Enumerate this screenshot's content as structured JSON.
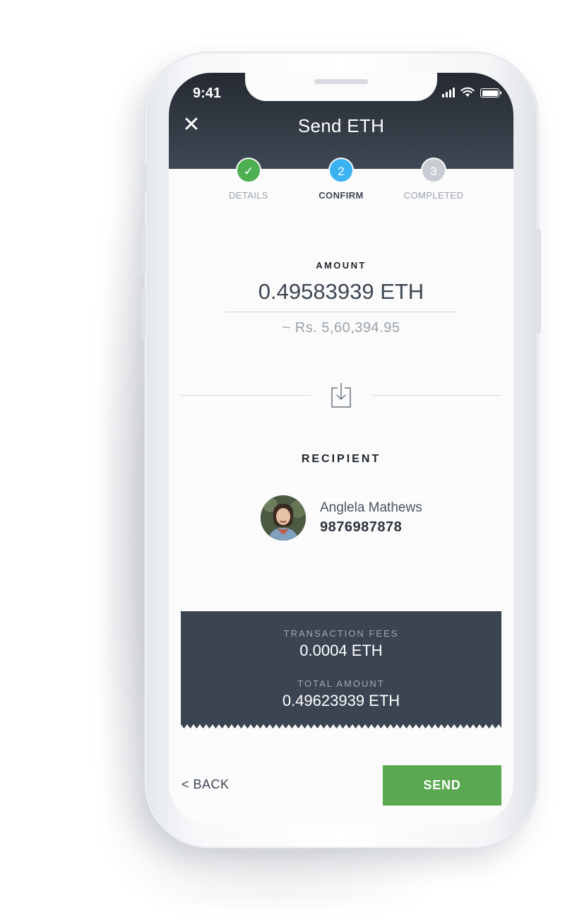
{
  "status_bar": {
    "time": "9:41"
  },
  "header": {
    "title": "Send ETH",
    "close_icon": "close-icon"
  },
  "steps": [
    {
      "label": "DETAILS",
      "marker": "✓",
      "state": "done",
      "color": "#4caf50"
    },
    {
      "label": "CONFIRM",
      "marker": "2",
      "state": "active",
      "color": "#3ab3f0"
    },
    {
      "label": "COMPLETED",
      "marker": "3",
      "state": "pending",
      "color": "#c9cdd3"
    }
  ],
  "amount": {
    "label": "AMOUNT",
    "value": "0.49583939 ETH",
    "fiat": "~ Rs. 5,60,394.95"
  },
  "recipient": {
    "label": "RECIPIENT",
    "name": "Anglela Mathews",
    "phone": "9876987878"
  },
  "summary": {
    "fees_label": "TRANSACTION FEES",
    "fees_value": "0.0004 ETH",
    "total_label": "TOTAL AMOUNT",
    "total_value": "0.49623939 ETH"
  },
  "actions": {
    "back_label": "< BACK",
    "send_label": "SEND"
  },
  "colors": {
    "header_dark": "#252a31",
    "receipt_bg": "#3b4552",
    "send_green": "#5aa84f",
    "accent_blue": "#3ab3f0"
  }
}
